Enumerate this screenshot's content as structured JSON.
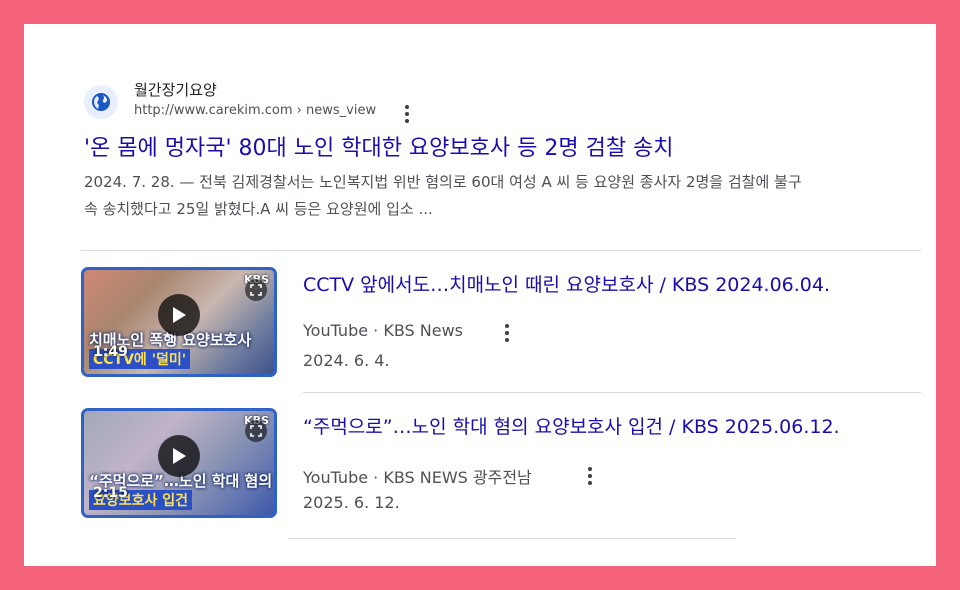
{
  "colors": {
    "background": "#f4637a",
    "link": "#1a0dab",
    "text_secondary": "#4d5156"
  },
  "result": {
    "site_name": "월간장기요양",
    "site_url": "http://www.carekim.com › news_view",
    "favicon_icon": "globe-icon",
    "title": "'온 몸에 멍자국' 80대 노인 학대한 요양보호사 등 2명 검찰 송치",
    "snippet_line1": "2024. 7. 28. — 전북 김제경찰서는 노인복지법 위반 혐의로 60대 여성 A 씨 등 요양원 종사자 2명을 검찰에 불구",
    "snippet_line2": "속 송치했다고 25일 밝혔다.A 씨 등은 요양원에 입소 ..."
  },
  "videos": [
    {
      "title": "CCTV 앞에서도…치매노인 때린 요양보호사 / KBS 2024.06.04.",
      "source": "YouTube · KBS News",
      "date": "2024. 6. 4.",
      "duration": "1:49",
      "thumb_caption": "치매노인 폭행 요양보호사",
      "thumb_sub": "CCTV에 '덜미'",
      "thumb_logo": "KBS"
    },
    {
      "title": "“주먹으로”…노인 학대 혐의 요양보호사 입건 / KBS 2025.06.12.",
      "source": "YouTube · KBS NEWS 광주전남",
      "date": "2025. 6. 12.",
      "duration": "2:15",
      "thumb_caption": "“주먹으로”…노인 학대 혐의",
      "thumb_sub": "요양보호사 입건",
      "thumb_logo": "KBS"
    }
  ]
}
